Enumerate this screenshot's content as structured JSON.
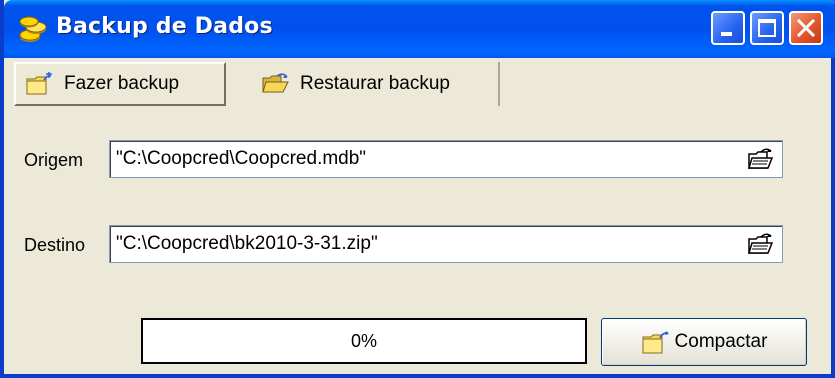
{
  "window": {
    "title": "Backup de Dados",
    "title_icon": "coins-icon",
    "controls": [
      "minimize-icon",
      "maximize-icon",
      "close-icon"
    ]
  },
  "tabs": [
    {
      "label": "Fazer backup",
      "icon": "folder-star-icon",
      "selected": true
    },
    {
      "label": "Restaurar backup",
      "icon": "open-folder-icon",
      "selected": false
    }
  ],
  "fields": {
    "origem": {
      "label": "Origem",
      "value": "\"C:\\Coopcred\\Coopcred.mdb\"",
      "browse_icon": "browse-folder-icon"
    },
    "destino": {
      "label": "Destino",
      "value": "\"C:\\Coopcred\\bk2010-3-31.zip\"",
      "browse_icon": "browse-folder-icon"
    }
  },
  "progress": {
    "value": 0,
    "text": "0%"
  },
  "action_button": {
    "label": "Compactar",
    "icon": "folder-star-icon"
  },
  "colors": {
    "titlebar": "#0054E3",
    "window_bg": "#ECE9D8",
    "close_button": "#E3572D"
  }
}
